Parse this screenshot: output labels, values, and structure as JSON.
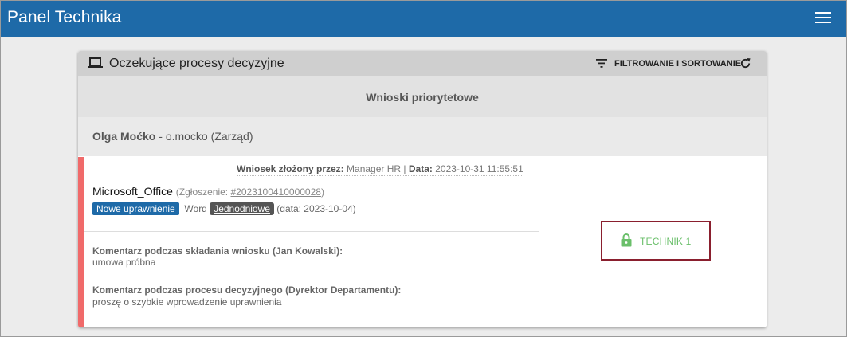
{
  "app": {
    "title": "Panel Technika",
    "menu_icon": "hamburger-menu-icon",
    "accent_color": "#1e6aa8"
  },
  "card": {
    "title": "Oczekujące procesy decyzyjne",
    "title_icon": "laptop-icon",
    "filter_label": "FILTROWANIE I SORTOWANIE",
    "filter_icon": "filter-list-icon",
    "refresh_icon": "refresh-icon"
  },
  "priority": {
    "title": "Wnioski priorytetowe"
  },
  "user": {
    "name": "Olga Moćko",
    "separator": " - ",
    "login_dept": "o.mocko (Zarząd)"
  },
  "request": {
    "accent_color": "#f06a6a",
    "submitted_by_label": "Wniosek złożony przez:",
    "submitted_by": "Manager HR",
    "meta_separator": " | ",
    "date_label": "Data:",
    "date": "2023-10-31 11:55:51",
    "app_name": "Microsoft_Office",
    "ticket_label_open": "(Zgłoszenie: ",
    "ticket_number": "#2023100410000028",
    "ticket_label_close": ")",
    "permission_badge": "Nowe uprawnienie",
    "permission_badge_color": "#1e6aa8",
    "role": "Word",
    "type_badge": "Jednodniowe",
    "type_date": "(data: 2023-10-04)",
    "comments": [
      {
        "label": "Komentarz podczas składania wniosku (Jan Kowalski):",
        "text": "umowa próbna"
      },
      {
        "label": "Komentarz podczas procesu decyzyjnego (Dyrektor Departamentu):",
        "text": "proszę o szybkie wprowadzenie uprawnienia"
      }
    ],
    "action": {
      "label": "TECHNIK 1",
      "icon": "lock-icon",
      "icon_color": "#6abf6a",
      "border_color": "#8a1f2e"
    }
  }
}
